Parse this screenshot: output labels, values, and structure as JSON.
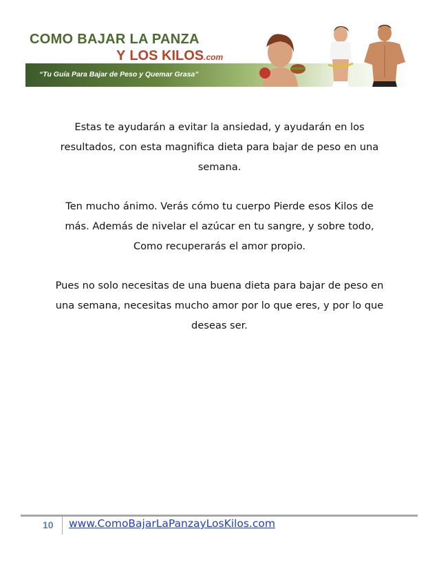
{
  "header": {
    "title_line1": "Como bajar la panza",
    "title_y": "y",
    "title_line2": "Los kilos",
    "title_dotcom": ".com",
    "tagline": "“Tu Guía Para Bajar de Peso y Quemar Grasa”",
    "band_colors": [
      "#3d5a2a",
      "#66853e",
      "#a7c07a",
      "#ffffff"
    ]
  },
  "body": {
    "paragraphs": [
      "Estas te ayudarán a evitar la ansiedad, y ayudarán en los\nresultados, con esta magnifica dieta para bajar de peso en una\nsemana.",
      "Ten mucho ánimo. Verás cómo tu cuerpo Pierde esos Kilos de\nmás. Además de  nivelar el azúcar en tu sangre, y sobre todo,\nComo  recuperarás el amor propio.",
      "Pues no solo necesitas de una buena dieta para bajar de peso en\nuna semana,  necesitas mucho amor por lo que eres, y por lo que\ndeseas ser."
    ]
  },
  "footer": {
    "page_number": "10",
    "link_text": "www.ComoBajarLaPanzayLosKilos.com",
    "page_number_color": "#4f81bd",
    "link_color": "#1f3fbf"
  }
}
